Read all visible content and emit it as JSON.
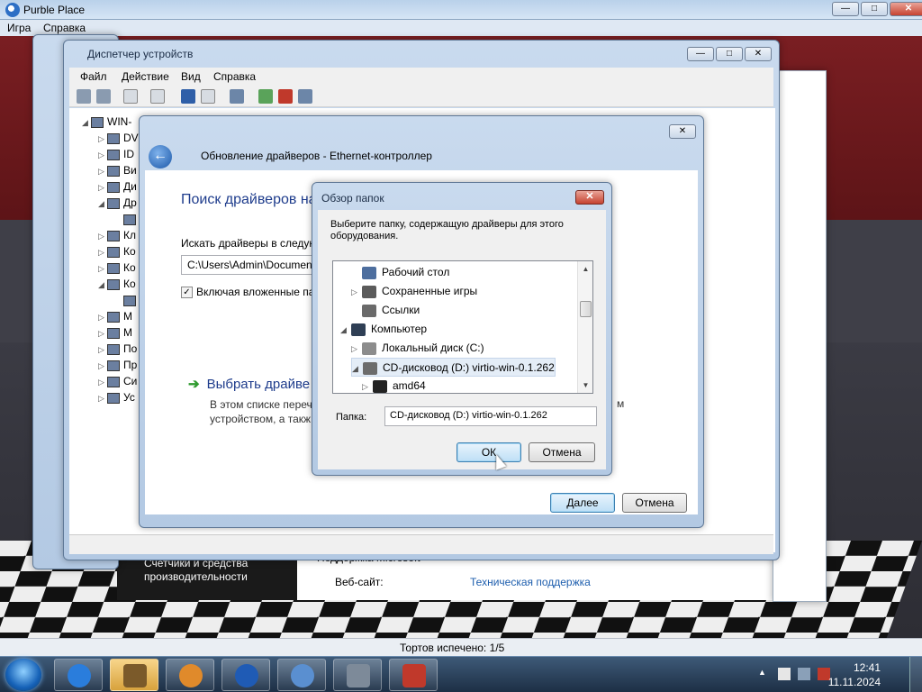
{
  "game": {
    "title": "Purble Place",
    "menu": [
      "Игра",
      "Справка"
    ],
    "status": "Тортов испечено: 1/5"
  },
  "system": {
    "left_text": "Счетчики и средства производительности",
    "support_heading": "Поддержка Microsoft",
    "website_label": "Веб-сайт:",
    "website_link": "Техническая поддержка"
  },
  "devmgr": {
    "title": "Диспетчер устройств",
    "menu": [
      "Файл",
      "Действие",
      "Вид",
      "Справка"
    ],
    "tree": [
      {
        "label": "WIN-",
        "indent": 0,
        "exp": "◢"
      },
      {
        "label": "DV",
        "indent": 1,
        "exp": "▷"
      },
      {
        "label": "ID",
        "indent": 1,
        "exp": "▷"
      },
      {
        "label": "Ви",
        "indent": 1,
        "exp": "▷"
      },
      {
        "label": "Ди",
        "indent": 1,
        "exp": "▷"
      },
      {
        "label": "Др",
        "indent": 1,
        "exp": "◢"
      },
      {
        "label": "",
        "indent": 2,
        "exp": ""
      },
      {
        "label": "Кл",
        "indent": 1,
        "exp": "▷"
      },
      {
        "label": "Ко",
        "indent": 1,
        "exp": "▷"
      },
      {
        "label": "Ко",
        "indent": 1,
        "exp": "▷"
      },
      {
        "label": "Ко",
        "indent": 1,
        "exp": "◢"
      },
      {
        "label": "",
        "indent": 2,
        "exp": ""
      },
      {
        "label": "М",
        "indent": 1,
        "exp": "▷"
      },
      {
        "label": "М",
        "indent": 1,
        "exp": "▷"
      },
      {
        "label": "По",
        "indent": 1,
        "exp": "▷"
      },
      {
        "label": "Пр",
        "indent": 1,
        "exp": "▷"
      },
      {
        "label": "Си",
        "indent": 1,
        "exp": "▷"
      },
      {
        "label": "Ус",
        "indent": 1,
        "exp": "▷"
      }
    ]
  },
  "wizard": {
    "title": "Обновление драйверов - Ethernet-контроллер",
    "heading": "Поиск драйверов на",
    "search_label": "Искать драйверы в следую",
    "path_value": "C:\\Users\\Admin\\Documen",
    "include_subfolders": "Включая вложенные па",
    "option_title": "Выбрать драйве",
    "option_desc_1": "В этом списке перечи",
    "option_desc_2": "устройством, а такж",
    "option_desc_tail": "м",
    "next_button": "Далее",
    "cancel_button": "Отмена"
  },
  "browse": {
    "title": "Обзор папок",
    "description": "Выберите папку, содержащую драйверы для этого оборудования.",
    "tree": [
      {
        "label": "Рабочий стол",
        "exp": "",
        "indent": 1,
        "icon_color": "#4d6e9e"
      },
      {
        "label": "Сохраненные игры",
        "exp": "▷",
        "indent": 1,
        "icon_color": "#5b5b5b"
      },
      {
        "label": "Ссылки",
        "exp": "",
        "indent": 1,
        "icon_color": "#6a6a6a"
      },
      {
        "label": "Компьютер",
        "exp": "◢",
        "indent": 0,
        "icon_color": "#2f3f55"
      },
      {
        "label": "Локальный диск (C:)",
        "exp": "▷",
        "indent": 1,
        "icon_color": "#8c8c8c"
      },
      {
        "label": "CD-дисковод (D:) virtio-win-0.1.262",
        "exp": "◢",
        "indent": 1,
        "icon_color": "#6c6c6c",
        "selected": true
      },
      {
        "label": "amd64",
        "exp": "▷",
        "indent": 2,
        "icon_color": "#222222"
      }
    ],
    "folder_label": "Папка:",
    "folder_value": "CD-дисковод (D:) virtio-win-0.1.262",
    "ok_button": "ОК",
    "cancel_button": "Отмена"
  },
  "taskbar": {
    "time": "12:41",
    "date": "11.11.2024",
    "buttons": [
      "internet-explorer-icon",
      "explorer-icon",
      "media-player-icon",
      "help-icon",
      "purble-place-icon",
      "device-manager-icon",
      "toolbox-icon"
    ]
  }
}
